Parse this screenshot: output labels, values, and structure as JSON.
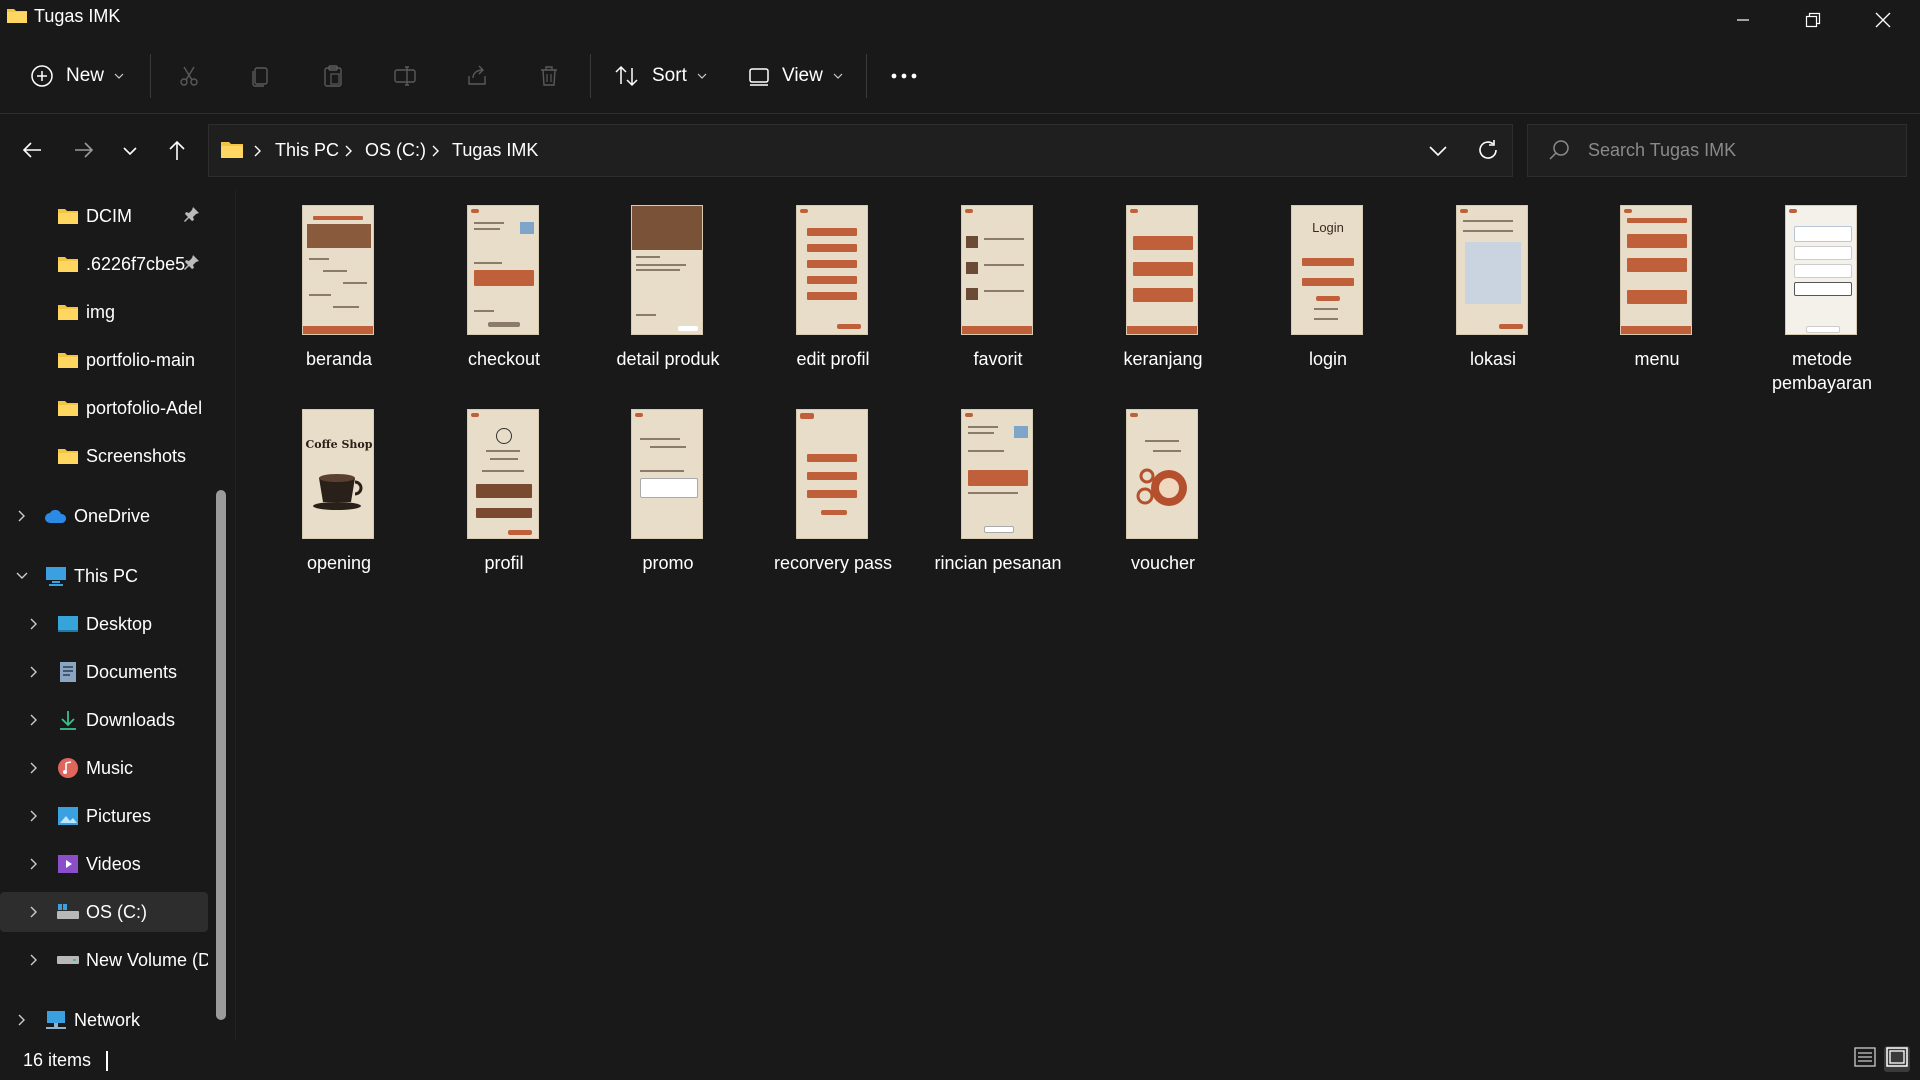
{
  "window": {
    "title": "Tugas IMK"
  },
  "commandbar": {
    "new_label": "New",
    "sort_label": "Sort",
    "view_label": "View"
  },
  "address": {
    "crumbs": [
      "This PC",
      "OS (C:)",
      "Tugas IMK"
    ]
  },
  "search": {
    "placeholder": "Search Tugas IMK"
  },
  "sidebar": {
    "items": [
      {
        "label": "DCIM",
        "pinned": true
      },
      {
        "label": ".6226f7cbe5",
        "pinned": true
      },
      {
        "label": "img"
      },
      {
        "label": "portfolio-main"
      },
      {
        "label": "portofolio-Adel"
      },
      {
        "label": "Screenshots"
      },
      {
        "label": "OneDrive"
      },
      {
        "label": "This PC"
      },
      {
        "label": "Desktop"
      },
      {
        "label": "Documents"
      },
      {
        "label": "Downloads"
      },
      {
        "label": "Music"
      },
      {
        "label": "Pictures"
      },
      {
        "label": "Videos"
      },
      {
        "label": "OS (C:)",
        "selected": true
      },
      {
        "label": "New Volume (D"
      },
      {
        "label": "Network"
      }
    ]
  },
  "files": [
    {
      "name": "beranda"
    },
    {
      "name": "checkout"
    },
    {
      "name": "detail produk"
    },
    {
      "name": "edit profil"
    },
    {
      "name": "favorit"
    },
    {
      "name": "keranjang"
    },
    {
      "name": "login"
    },
    {
      "name": "lokasi"
    },
    {
      "name": "menu"
    },
    {
      "name": "metode pembayaran"
    },
    {
      "name": "opening"
    },
    {
      "name": "profil"
    },
    {
      "name": "promo"
    },
    {
      "name": "recorvery pass"
    },
    {
      "name": "rincian pesanan"
    },
    {
      "name": "voucher"
    }
  ],
  "thumb_text": {
    "login": "Login",
    "opening": "Coffe Shop"
  },
  "status": {
    "count": "16 items"
  },
  "colors": {
    "background": "#191919",
    "thumb_paper": "#e8ddc8",
    "accent_brown": "#c0603a",
    "folder_yellow": "#f5c542"
  }
}
